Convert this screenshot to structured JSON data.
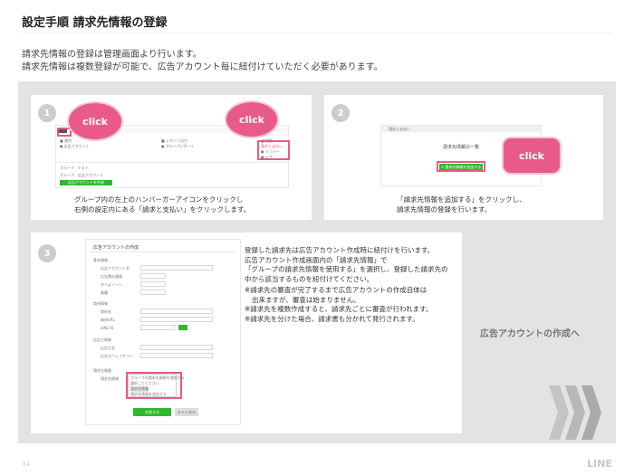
{
  "header": {
    "title": "設定手順 請求先情報の登録"
  },
  "intro": {
    "line1": "請求先情報の登録は管理画面より行います。",
    "line2": "請求先情報は複数登録が可能で、広告アカウント毎に紐付けていただく必要があります。"
  },
  "steps": {
    "step1": {
      "number": "1",
      "click_left": "click",
      "click_right": "click",
      "caption_line1": "グループ内の左上のハンバーガーアイコンをクリックし",
      "caption_line2": "右側の設定内にある「請求と支払い」をクリックします。",
      "mock": {
        "nav_col1_head": "■ 運用",
        "nav_col1_item": "● 広告アカウント",
        "nav_col2_head": "■ レポート出力",
        "nav_col2_item": "● グループレポート",
        "nav_col3_head": "■ 設定",
        "nav_col3_item1": "請求と支払い",
        "nav_col3_item2": "● メンバー",
        "nav_col3_item3": "● ログ",
        "group_title": "グループ　テスト",
        "tab1": "グループ",
        "tab2": "広告アカウント",
        "action_label": "広告アカウントを作成"
      }
    },
    "step2": {
      "number": "2",
      "click": "click",
      "caption_line1": "「請求先情報を追加する」をクリックし、",
      "caption_line2": "請求先情報の登録を行います。",
      "mock": {
        "header": "請求と支払い",
        "list_title": "請求先情報の一覧",
        "add_button": "+ 請求先情報を追加する"
      }
    },
    "step3": {
      "number": "3",
      "mock": {
        "form_title": "広告アカウントの作成",
        "section_basic": "基本情報",
        "label_account_name": "広告アカウント名",
        "label_currency": "広告費の通貨",
        "label_timezone": "タイムゾーン",
        "label_industry": "業種",
        "section_site": "商材情報",
        "label_site_name": "商材名",
        "label_site_url": "商材URL",
        "label_line_id": "LINE ID",
        "section_ad": "広告主情報",
        "label_ad_name": "広告主名",
        "label_ad_url": "広告主ウェブサイト",
        "section_billing": "請求先情報",
        "label_billing": "請求先情報",
        "option1": "グループの請求先情報を使用する",
        "option2": "選択してください",
        "option3": "請求先情報",
        "option4": "請求先情報を追加する",
        "btn_create": "作成する",
        "btn_cancel": "キャンセル"
      }
    }
  },
  "description": {
    "line1": "登録した請求先は広告アカウント作成時に紐付けを行います。",
    "line2": "広告アカウント作成画面内の「請求先情報」で",
    "line3": "「グループの請求先情報を使用する」を選択し、登録した請求先の",
    "line4": "中から該当するものを紐付けてください。",
    "note1": "※請求先の審査が完了するまで広告アカウントの作成自体は",
    "note1b": "出来ますが、審査は始まりません。",
    "note2": "※請求先を複数作成すると、請求先ごとに審査が行われます。",
    "note3": "※請求先を分けた場合、請求書も分かれて発行されます。"
  },
  "next_label": "広告アカウントの作成へ",
  "footer": {
    "page": "34",
    "brand": "LINE"
  },
  "colors": {
    "accent": "#e85a8a",
    "green": "#2eb82e",
    "panel": "#e3e3e3"
  }
}
